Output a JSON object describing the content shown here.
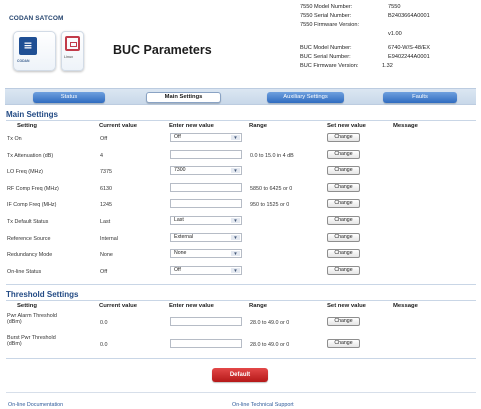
{
  "header": {
    "brand": "CODAN SATCOM",
    "logo_caption": "CODAN",
    "partner_caption": "Linux",
    "title": "BUC Parameters",
    "info": [
      {
        "label": "7550 Model Number:",
        "value": "7550"
      },
      {
        "label": "7550 Serial Number:",
        "value": "B2403664A0001"
      },
      {
        "label": "7550 Firmware Version:",
        "value": "v1.00"
      },
      {
        "label": "BUC Model Number:",
        "value": "6740-W/S-48/EX"
      },
      {
        "label": "BUC Serial Number:",
        "value": "E9402244A0001"
      },
      {
        "label": "BUC Firmware Version:",
        "value": "1.32"
      }
    ]
  },
  "nav": {
    "tabs": [
      {
        "label": "Status"
      },
      {
        "label": "Main Settings"
      },
      {
        "label": "Auxiliary Settings"
      },
      {
        "label": "Faults"
      }
    ]
  },
  "columns": {
    "setting": "Setting",
    "current": "Current value",
    "enter": "Enter new value",
    "range": "Range",
    "set": "Set new value",
    "message": "Message"
  },
  "main_settings": {
    "title": "Main Settings",
    "rows": [
      {
        "setting": "Tx On",
        "current": "Off",
        "input_type": "select",
        "selected": "Off",
        "range": "",
        "button": "Change"
      },
      {
        "setting": "Tx Attenuation (dB)",
        "current": "4",
        "input_type": "text",
        "selected": "",
        "range": "0.0 to 15.0 in 4 dB",
        "button": "Change"
      },
      {
        "setting": "LO Freq (MHz)",
        "current": "7375",
        "input_type": "select",
        "selected": "7300",
        "range": "",
        "button": "Change"
      },
      {
        "setting": "RF Comp Freq (MHz)",
        "current": "6130",
        "input_type": "text",
        "selected": "",
        "range": "5850 to 6425 or 0",
        "button": "Change"
      },
      {
        "setting": "IF Comp Freq (MHz)",
        "current": "1245",
        "input_type": "text",
        "selected": "",
        "range": "950 to 1525 or 0",
        "button": "Change"
      },
      {
        "setting": "Tx Default Status",
        "current": "Last",
        "input_type": "select",
        "selected": "Last",
        "range": "",
        "button": "Change"
      },
      {
        "setting": "Reference Source",
        "current": "Internal",
        "input_type": "select",
        "selected": "External",
        "range": "",
        "button": "Change"
      },
      {
        "setting": "Redundancy Mode",
        "current": "None",
        "input_type": "select",
        "selected": "None",
        "range": "",
        "button": "Change"
      },
      {
        "setting": "On-line Status",
        "current": "Off",
        "input_type": "select",
        "selected": "Off",
        "range": "",
        "button": "Change"
      }
    ]
  },
  "threshold_settings": {
    "title": "Threshold Settings",
    "rows": [
      {
        "setting": "Pwr Alarm Threshold (dBm)",
        "current": "0.0",
        "input_type": "text",
        "selected": "",
        "range": "28.0 to 49.0 or 0",
        "button": "Change"
      },
      {
        "setting": "Burst Pwr Threshold (dBm)",
        "current": "0.0",
        "input_type": "text",
        "selected": "",
        "range": "28.0 to 49.0 or 0",
        "button": "Change"
      }
    ]
  },
  "default_button": "Default",
  "footer": {
    "links": [
      {
        "label": "On-line Documentation"
      },
      {
        "label": "On-line Technical Support"
      }
    ]
  },
  "colors": {
    "section_title": "#224a84",
    "nav_button": "#2f6cc0",
    "default_button": "#c92a2a"
  }
}
